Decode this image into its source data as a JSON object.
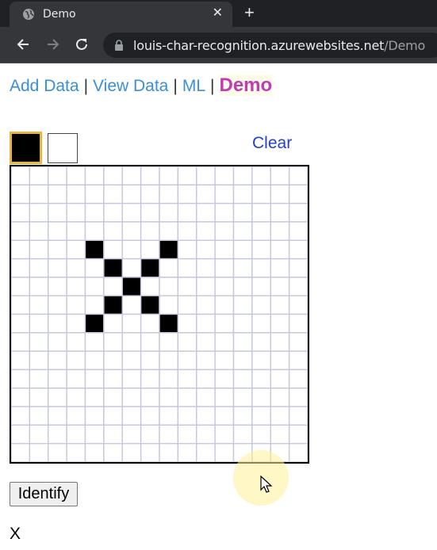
{
  "browser": {
    "tab_title": "Demo",
    "tab_close": "✕",
    "new_tab": "+",
    "url_host": "louis-char-recognition.azurewebsites.net",
    "url_path": "/Demo"
  },
  "nav": {
    "links": [
      "Add Data",
      "View Data",
      "ML"
    ],
    "separator": "|",
    "active": "Demo"
  },
  "palette": {
    "colors": [
      "#000000",
      "#ffffff"
    ],
    "selected_index": 0
  },
  "clear_label": "Clear",
  "grid": {
    "rows": 16,
    "cols": 16,
    "filled_cells": [
      [
        4,
        4
      ],
      [
        4,
        8
      ],
      [
        5,
        5
      ],
      [
        5,
        7
      ],
      [
        6,
        6
      ],
      [
        7,
        5
      ],
      [
        7,
        7
      ],
      [
        8,
        4
      ],
      [
        8,
        8
      ]
    ]
  },
  "identify_label": "Identify",
  "result": "X"
}
